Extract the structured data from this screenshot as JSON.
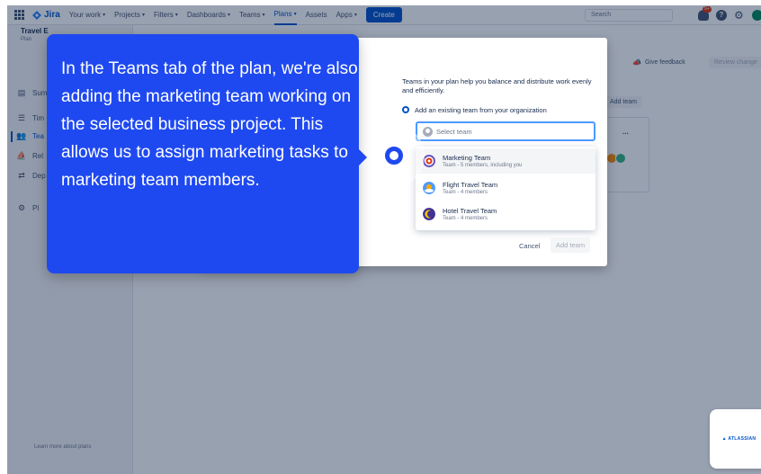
{
  "topnav": {
    "app_name": "Jira",
    "items": [
      {
        "label": "Your work",
        "chevron": true
      },
      {
        "label": "Projects",
        "chevron": true
      },
      {
        "label": "Filters",
        "chevron": true
      },
      {
        "label": "Dashboards",
        "chevron": true
      },
      {
        "label": "Teams",
        "chevron": true
      },
      {
        "label": "Plans",
        "chevron": true
      },
      {
        "label": "Assets",
        "chevron": false
      },
      {
        "label": "Apps",
        "chevron": true
      }
    ],
    "active_item": "Plans",
    "create_label": "Create",
    "search_placeholder": "Search",
    "notification_count": "9+"
  },
  "sidebar": {
    "plan_title": "Travel E",
    "plan_subtitle": "Plan",
    "items": [
      {
        "icon": "summary-icon",
        "label": "Sum"
      },
      {
        "icon": "timeline-icon",
        "label": "Tim"
      },
      {
        "icon": "teams-icon",
        "label": "Tea"
      },
      {
        "icon": "releases-icon",
        "label": "Rel"
      },
      {
        "icon": "dependencies-icon",
        "label": "Dep"
      },
      {
        "icon": "settings-icon",
        "label": "Pl"
      }
    ],
    "active_index": 2,
    "footer": "Learn more about plans"
  },
  "page": {
    "give_feedback": "Give feedback",
    "review_changes": "Review change",
    "add_team": "Add team",
    "card_more": "..."
  },
  "modal": {
    "description": "Teams in your plan help you balance and distribute work evenly and efficiently.",
    "radio_label": "Add an existing team from your organization",
    "select_placeholder": "Select team",
    "options": [
      {
        "name": "Marketing Team",
        "meta": "Team - 5 members, including you",
        "icon": "target-icon",
        "highlighted": true
      },
      {
        "name": "Flight Travel Team",
        "meta": "Team - 4 members",
        "icon": "sun-cloud-icon",
        "highlighted": false
      },
      {
        "name": "Hotel Travel Team",
        "meta": "Team - 4 members",
        "icon": "moon-icon",
        "highlighted": false
      }
    ],
    "cancel_label": "Cancel",
    "add_team_label": "Add team"
  },
  "tooltip": {
    "text": "In the Teams tab of the plan, we're also adding the marketing team working on the selected business project. This allows us to assign marketing tasks to marketing team members."
  },
  "badge": {
    "text": "ATLASSIAN"
  },
  "colors": {
    "tour_accent": "#1f49f0",
    "jira_blue": "#0052cc",
    "focus_ring": "#4c9aff"
  }
}
